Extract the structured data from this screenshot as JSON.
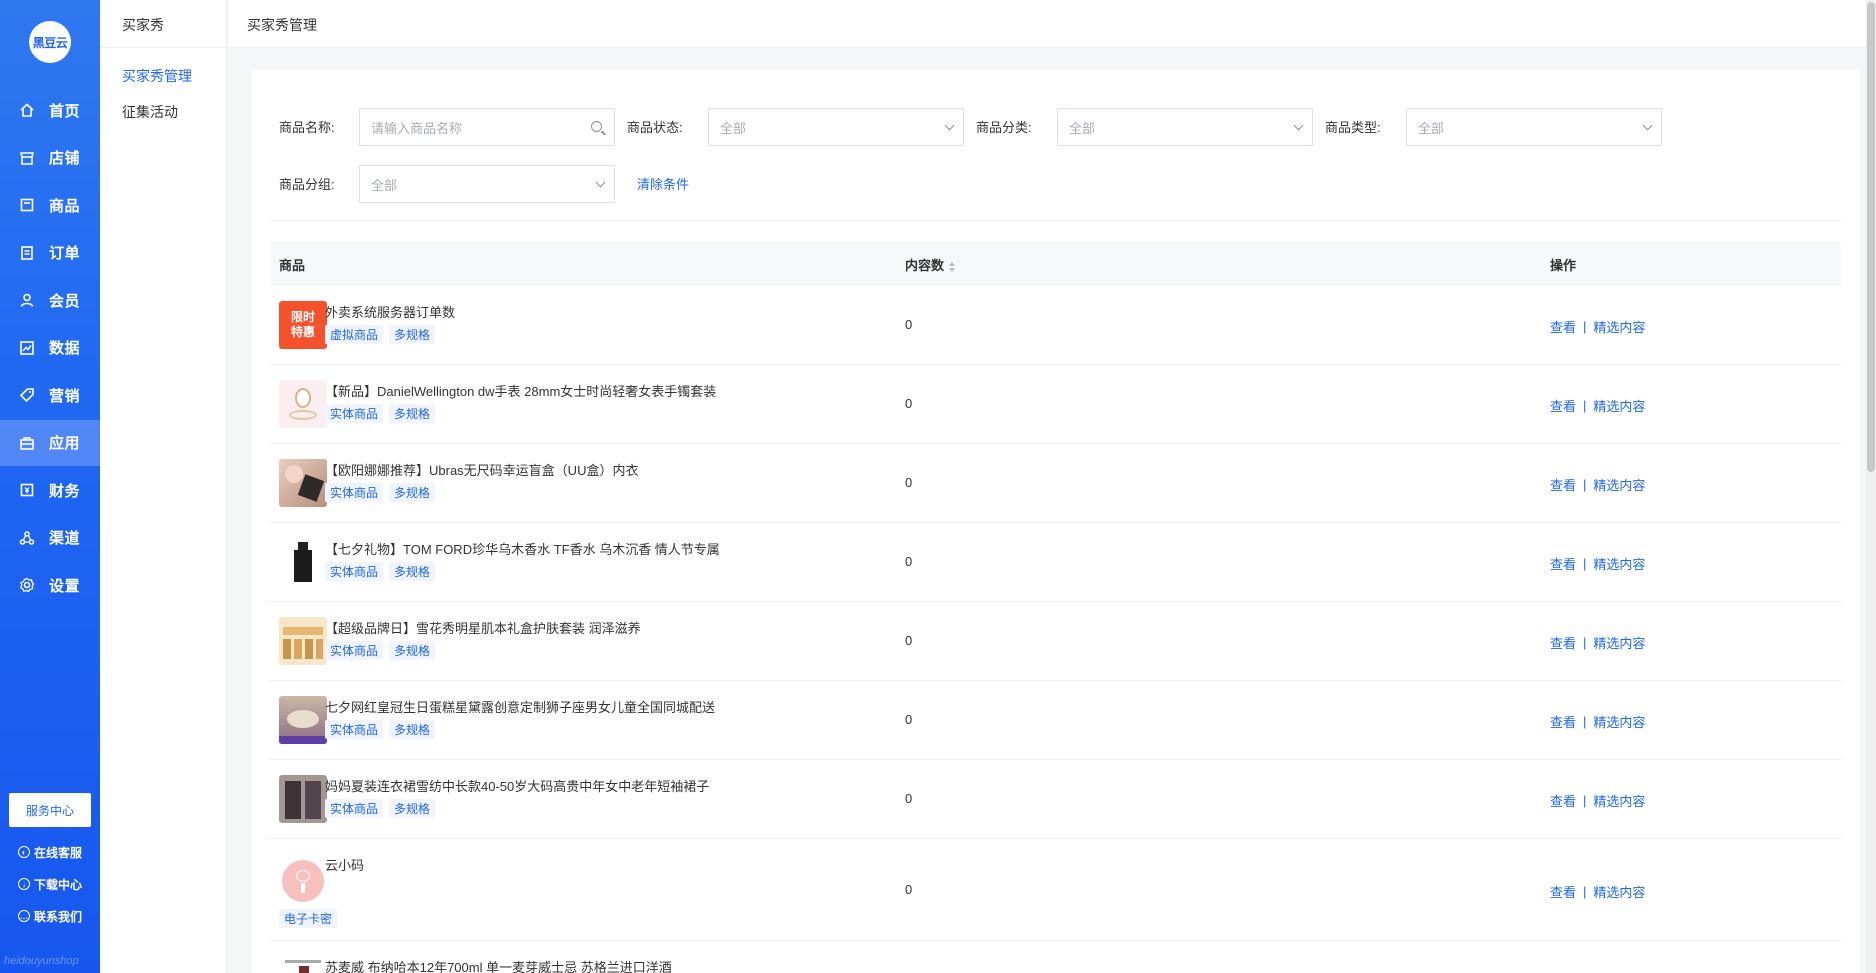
{
  "app": {
    "logo_text": "黑豆云",
    "watermark": "heidouyunshop"
  },
  "sidebar": {
    "items": [
      {
        "label": "首页",
        "icon": "home-icon"
      },
      {
        "label": "店铺",
        "icon": "store-icon"
      },
      {
        "label": "商品",
        "icon": "goods-icon"
      },
      {
        "label": "订单",
        "icon": "order-icon"
      },
      {
        "label": "会员",
        "icon": "member-icon"
      },
      {
        "label": "数据",
        "icon": "chart-icon"
      },
      {
        "label": "营销",
        "icon": "tag-icon"
      },
      {
        "label": "应用",
        "icon": "app-icon",
        "active": true
      },
      {
        "label": "财务",
        "icon": "finance-icon"
      },
      {
        "label": "渠道",
        "icon": "channel-icon"
      },
      {
        "label": "设置",
        "icon": "gear-icon"
      }
    ],
    "service_center": "服务中心",
    "links": [
      {
        "label": "在线客服",
        "icon": "chat-icon"
      },
      {
        "label": "下载中心",
        "icon": "download-icon"
      },
      {
        "label": "联系我们",
        "icon": "contact-icon"
      }
    ]
  },
  "subnav": {
    "title": "买家秀",
    "items": [
      {
        "label": "买家秀管理",
        "active": true
      },
      {
        "label": "征集活动",
        "active": false
      }
    ]
  },
  "header": {
    "title": "买家秀管理"
  },
  "filters": {
    "name_label": "商品名称:",
    "name_placeholder": "请输入商品名称",
    "status_label": "商品状态:",
    "status_value": "全部",
    "category_label": "商品分类:",
    "category_value": "全部",
    "type_label": "商品类型:",
    "type_value": "全部",
    "group_label": "商品分组:",
    "group_value": "全部",
    "clear_label": "清除条件"
  },
  "table": {
    "columns": [
      "商品",
      "内容数",
      "操作"
    ],
    "view_label": "查看",
    "select_label": "精选内容",
    "rows": [
      {
        "name": "外卖系统服务器订单数",
        "tags": [
          "虚拟商品",
          "多规格"
        ],
        "count": "0",
        "thumb_text": "限时特惠",
        "thumb": "promo"
      },
      {
        "name": "【新品】DanielWellington dw手表 28mm女士时尚轻奢女表手镯套装",
        "tags": [
          "实体商品",
          "多规格"
        ],
        "count": "0",
        "thumb": "watch"
      },
      {
        "name": "【欧阳娜娜推荐】Ubras无尺码幸运盲盒（UU盒）内衣",
        "tags": [
          "实体商品",
          "多规格"
        ],
        "count": "0",
        "thumb": "portrait"
      },
      {
        "name": "【七夕礼物】TOM FORD珍华乌木香水 TF香水 乌木沉香 情人节专属",
        "tags": [
          "实体商品",
          "多规格"
        ],
        "count": "0",
        "thumb": "perfume"
      },
      {
        "name": "【超级品牌日】雪花秀明星肌本礼盒护肤套装 润泽滋养",
        "tags": [
          "实体商品",
          "多规格"
        ],
        "count": "0",
        "thumb": "cosmetics"
      },
      {
        "name": "七夕网红皇冠生日蛋糕星黛露创意定制狮子座男女儿童全国同城配送",
        "tags": [
          "实体商品",
          "多规格"
        ],
        "count": "0",
        "thumb": "cake"
      },
      {
        "name": "妈妈夏装连衣裙雪纺中长款40-50岁大码高贵中年女中老年短袖裙子",
        "tags": [
          "实体商品",
          "多规格"
        ],
        "count": "0",
        "thumb": "dress"
      },
      {
        "name": "云小码",
        "tags": [
          "电子卡密"
        ],
        "count": "0",
        "thumb": "mascot"
      },
      {
        "name": "苏麦威 布纳哈本12年700ml 单一麦芽威士忌 苏格兰进口洋酒",
        "tags": [],
        "count": "",
        "thumb": "whisky"
      }
    ]
  }
}
